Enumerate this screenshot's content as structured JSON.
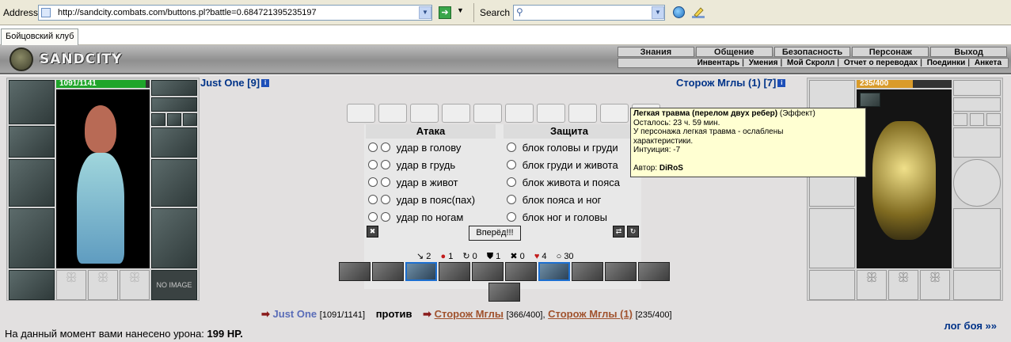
{
  "browser": {
    "address_label": "Address",
    "url": "http://sandcity.combats.com/buttons.pl?battle=0.684721395235197",
    "search_label": "Search",
    "tab_title": "Бойцовский клуб"
  },
  "header": {
    "logo_text": "SANDCITY",
    "menu_top": [
      "Знания",
      "Общение",
      "Безопасность",
      "Персонаж",
      "Выход"
    ],
    "menu_bottom": [
      "Инвентарь",
      "Умения",
      "Мой Скролл",
      "Отчет о переводах",
      "Поединки",
      "Анкета"
    ]
  },
  "player": {
    "name": "Just One [9]",
    "hp_text": "1091/1141",
    "hp_fraction": 0.956,
    "noimage_label": "NO IMAGE"
  },
  "opponent": {
    "name": "Сторож Мглы (1) [7]",
    "hp_text": "235/400",
    "hp_fraction": 0.5875
  },
  "fight": {
    "attack_header": "Атака",
    "defense_header": "Защита",
    "attacks": [
      "удар в голову",
      "удар в грудь",
      "удар в живот",
      "удар в пояс(пах)",
      "удар по ногам"
    ],
    "defenses": [
      "блок головы и груди",
      "блок груди и живота",
      "блок живота и пояса",
      "блок пояса и ног",
      "блок ног и головы"
    ],
    "forward_button": "Вперёд!!!"
  },
  "stats": [
    {
      "icon": "sword-icon",
      "glyph": "↘",
      "value": "2"
    },
    {
      "icon": "blood-icon",
      "glyph": "●",
      "value": "1"
    },
    {
      "icon": "counter-icon",
      "glyph": "↻",
      "value": "0"
    },
    {
      "icon": "block-icon",
      "glyph": "⛊",
      "value": "1"
    },
    {
      "icon": "parry-icon",
      "glyph": "✖",
      "value": "0"
    },
    {
      "icon": "heart-icon",
      "glyph": "♥",
      "value": "4"
    },
    {
      "icon": "spirit-icon",
      "glyph": "○",
      "value": "30"
    }
  ],
  "versus": {
    "me_name": "Just One",
    "me_hp": "[1091/1141]",
    "vs_label": "против",
    "enemy1_name": "Сторож Мглы",
    "enemy1_hp": "[366/400],",
    "enemy2_name": "Сторож Мглы (1)",
    "enemy2_hp": "[235/400]"
  },
  "damage": {
    "text": "На данный момент вами нанесено урона:",
    "value": "199 HP."
  },
  "log_link": "лог боя »»",
  "tooltip": {
    "title": "Легкая травма (перелом двух ребер)",
    "title_suffix": "(Эффект)",
    "remaining": "Осталось: 23 ч. 59 мин.",
    "desc1": "У персонажа легкая травма - ослаблены",
    "desc2": "характеристики.",
    "stat": "Интуиция: -7",
    "author_label": "Автор:",
    "author": "DiRoS"
  },
  "colors": {
    "player_hp": "#1fa52a",
    "enemy_hp": "#d99b2a",
    "link_blue": "#003388",
    "enemy_link": "#a0522d",
    "tooltip_bg": "#ffffd2"
  }
}
